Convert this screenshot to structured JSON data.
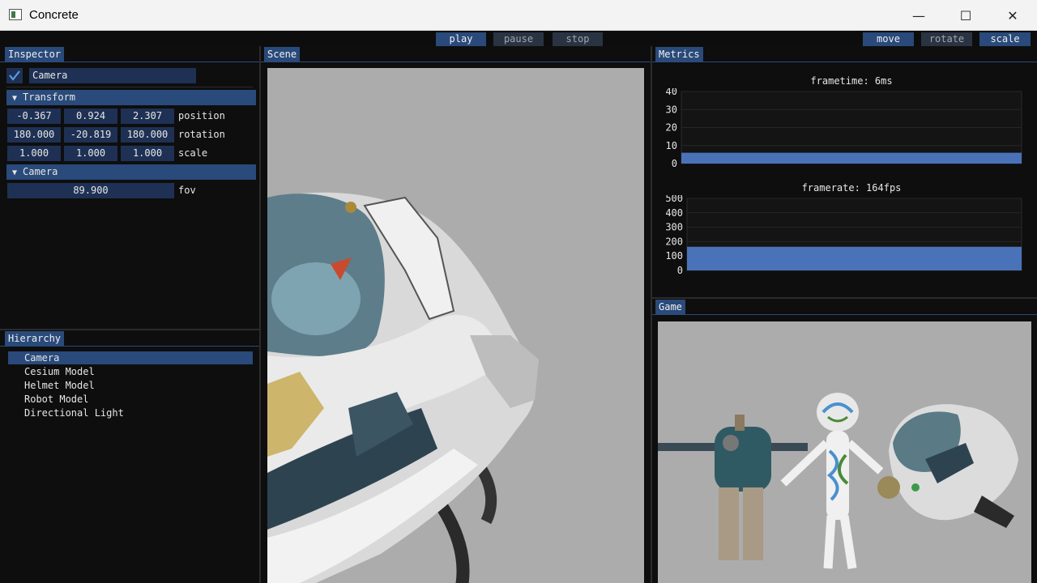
{
  "window": {
    "title": "Concrete",
    "minimize_glyph": "—",
    "maximize_glyph": "☐",
    "close_glyph": "✕"
  },
  "toolbar": {
    "playback": [
      {
        "label": "play",
        "active": true
      },
      {
        "label": "pause",
        "active": false
      },
      {
        "label": "stop",
        "active": false
      }
    ],
    "transform_modes": [
      {
        "label": "move",
        "active": true
      },
      {
        "label": "rotate",
        "active": false
      },
      {
        "label": "scale",
        "active": true
      }
    ]
  },
  "inspector": {
    "tab": "Inspector",
    "entity_enabled": true,
    "entity_name": "Camera",
    "transform": {
      "header": "Transform",
      "position": {
        "label": "position",
        "values": [
          "-0.367",
          "0.924",
          "2.307"
        ]
      },
      "rotation": {
        "label": "rotation",
        "values": [
          "180.000",
          "-20.819",
          "180.000"
        ]
      },
      "scale": {
        "label": "scale",
        "values": [
          "1.000",
          "1.000",
          "1.000"
        ]
      }
    },
    "camera": {
      "header": "Camera",
      "fov": {
        "label": "fov",
        "value": "89.900"
      }
    }
  },
  "hierarchy": {
    "tab": "Hierarchy",
    "items": [
      {
        "label": "Camera",
        "selected": true
      },
      {
        "label": "Cesium Model",
        "selected": false
      },
      {
        "label": "Helmet Model",
        "selected": false
      },
      {
        "label": "Robot Model",
        "selected": false
      },
      {
        "label": "Directional Light",
        "selected": false
      }
    ]
  },
  "scene": {
    "tab": "Scene"
  },
  "game": {
    "tab": "Game"
  },
  "metrics": {
    "tab": "Metrics",
    "colors": {
      "fill": "#4a72b8",
      "accent": "#294a7a"
    }
  },
  "chart_data": [
    {
      "type": "area",
      "title": "frametime: 6ms",
      "yticks": [
        "40",
        "30",
        "20",
        "10",
        "0"
      ],
      "ylim": [
        0,
        40
      ],
      "values": [
        6,
        6,
        6,
        6,
        6,
        6,
        6,
        6,
        6,
        6,
        6,
        6,
        6,
        6,
        6,
        6,
        6,
        6,
        6,
        6
      ]
    },
    {
      "type": "area",
      "title": "framerate: 164fps",
      "yticks": [
        "500",
        "400",
        "300",
        "200",
        "100",
        "0"
      ],
      "ylim": [
        0,
        500
      ],
      "values": [
        164,
        164,
        164,
        164,
        164,
        164,
        164,
        164,
        164,
        164,
        164,
        164,
        164,
        164,
        164,
        164,
        164,
        164,
        164,
        164
      ]
    }
  ]
}
